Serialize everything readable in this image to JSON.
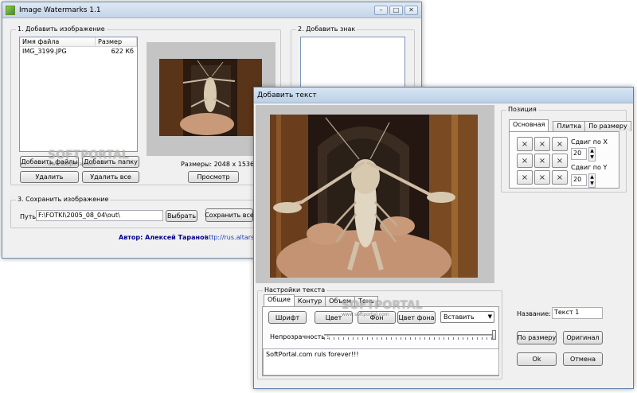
{
  "main_window": {
    "title": "Image Watermarks 1.1",
    "group_add_image": "1. Добавить изображение",
    "group_add_mark": "2. Добавить знак",
    "list_columns": [
      "Имя файла",
      "Размер"
    ],
    "files": [
      {
        "name": "IMG_3199.JPG",
        "size": "622 Кб"
      }
    ],
    "add_files_button": "Добавить файлы",
    "add_folder_button": "Добавить папку",
    "delete_button": "Удалить",
    "delete_all_button": "Удалить все",
    "dimensions_text": "Размеры: 2048 x 1536",
    "preview_button": "Просмотр",
    "group_save": "3. Сохранить изображение",
    "path_label": "Путь:",
    "path_value": "F:\\FOTKI\\2005_08_04\\out\\",
    "browse_button": "Выбрать",
    "save_all_button": "Сохранить все",
    "author_text": "Автор: Алексей Таранов",
    "url_text": "http://rus.altarsoft.co"
  },
  "dialog": {
    "title": "Добавить текст",
    "position_group": "Позиция",
    "position_tabs": [
      "Основная",
      "Плитка",
      "По размеру"
    ],
    "grid_symbol": "×",
    "shift_x_label": "Сдвиг по X",
    "shift_x_value": "20",
    "shift_y_label": "Сдвиг по Y",
    "shift_y_value": "20",
    "text_settings_group": "Настройки текста",
    "text_tabs": [
      "Общие",
      "Контур",
      "Объем",
      "Тень"
    ],
    "font_button": "Шрифт",
    "color_button": "Цвет",
    "background_button": "Фон",
    "bg_color_button": "Цвет фона",
    "insert_select": "Вставить",
    "opacity_label": "Непрозрачность :",
    "opacity_fraction": 1.0,
    "text_content": "SoftPortal.com ruls forever!!!",
    "name_label": "Название:",
    "name_value": "Текст 1",
    "fit_button": "По размеру",
    "original_button": "Оригинал",
    "ok_button": "Ok",
    "cancel_button": "Отмена"
  },
  "watermarks": {
    "brand": "SOFTPORTAL",
    "site": "www.softportal.com"
  },
  "window_controls": {
    "minimize": "–",
    "maximize": "□",
    "close": "✕"
  },
  "colors": {
    "author_color": "#00008b",
    "link_color": "#1a3fb8",
    "title_bar_top": "#dfe9f5"
  }
}
